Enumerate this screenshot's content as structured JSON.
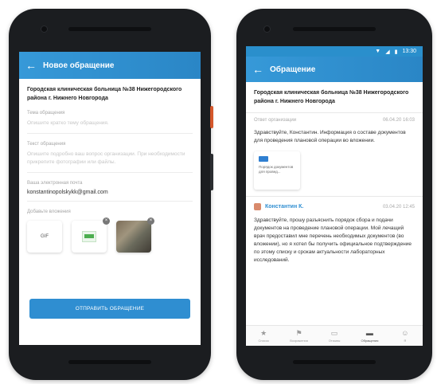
{
  "left_screen": {
    "title": "Новое обращение",
    "back_icon": "arrow-left-icon",
    "hospital": "Городская клиническая больница №38 Нижегородского района г. Нижнего Новгорода",
    "subject_label": "Тема обращения",
    "subject_placeholder": "Опишите кратко тему обращения.",
    "text_label": "Текст обращения",
    "text_placeholder": "Опишите подробно ваш вопрос организации. При необходимости прикрепите фотографии или файлы.",
    "email_label": "Ваша электронная почта",
    "email_value": "konstantinopolskykk@gmail.com",
    "attach_label": "Добавьте вложения",
    "attachments": [
      {
        "type": "format",
        "label": "GIF"
      },
      {
        "type": "document",
        "label": ""
      },
      {
        "type": "photo",
        "label": ""
      }
    ],
    "send_label": "ОТПРАВИТЬ ОБРАЩЕНИЕ"
  },
  "right_screen": {
    "status_time": "13:30",
    "title": "Обращение",
    "back_icon": "arrow-left-icon",
    "hospital": "Городская клиническая больница №38 Нижегородского района г. Нижнего Новгорода",
    "org_label": "Ответ организации",
    "org_date": "06.04.20 16:03",
    "org_message": "Здравствуйте, Константин. Информация о составе документов для проведения плановой операции во вложении.",
    "file_name": "Порядок документов для провед...",
    "user_name": "Константин К.",
    "user_date": "03.04.20 12:45",
    "user_message": "Здравствуйте, прошу разъяснить порядок сбора и подачи документов на проведение плановой операции. Мой лечащий врач предоставил мне перечень необходимых документов (во вложении), но я хотел бы получить официальное подтверждение по этому списку и срокам актуальности лабораторных исследований.",
    "tabs": [
      {
        "icon": "star-icon",
        "label": "Список",
        "active": false
      },
      {
        "icon": "flag-icon",
        "label": "Возражения",
        "active": false
      },
      {
        "icon": "comment-icon",
        "label": "Отзывы",
        "active": false
      },
      {
        "icon": "chat-icon",
        "label": "Обращения",
        "active": true
      },
      {
        "icon": "user-icon",
        "label": "Я"
      }
    ]
  },
  "colors": {
    "accent": "#2f8ed1",
    "phone_body": "#1b1d20"
  }
}
